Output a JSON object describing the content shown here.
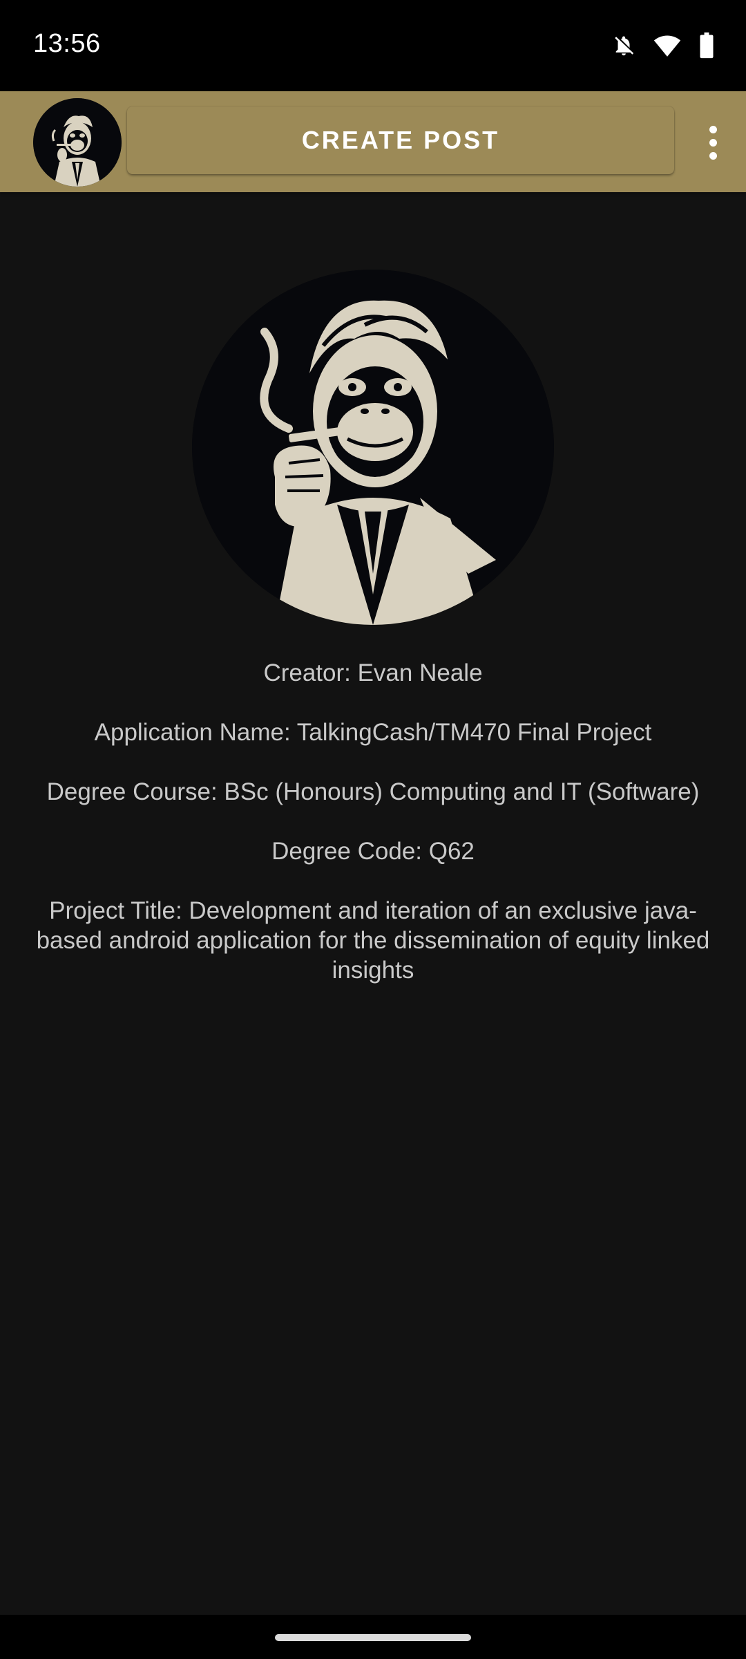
{
  "status_bar": {
    "time": "13:56",
    "icons": [
      "notifications-off-icon",
      "wifi-icon",
      "battery-icon"
    ]
  },
  "app_bar": {
    "avatar": "monkey-avatar-icon",
    "create_post_label": "CREATE POST",
    "menu_icon": "overflow-menu-icon",
    "background_color": "#9c8a57"
  },
  "profile": {
    "image": "monkey-in-suit-smoking-cigar"
  },
  "info": {
    "creator": "Creator: Evan Neale",
    "application_name": "Application Name: TalkingCash/TM470 Final Project",
    "degree_course": "Degree Course: BSc (Honours) Computing and IT (Software)",
    "degree_code": "Degree Code: Q62",
    "project_title": "Project Title: Development and iteration of an exclusive java-based android application for the dissemination of equity linked insights"
  },
  "colors": {
    "background": "#121212",
    "text": "#c9c9c9",
    "accent": "#9c8a57"
  }
}
